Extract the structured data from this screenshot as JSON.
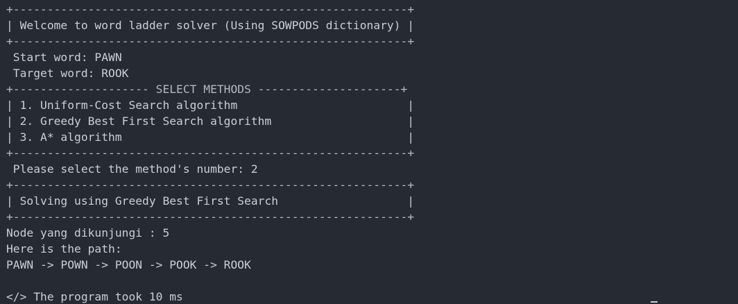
{
  "terminal": {
    "lines": [
      "+----------------------------------------------------------+",
      "| Welcome to word ladder solver (Using SOWPODS dictionary) |",
      "+----------------------------------------------------------+",
      " Start word: PAWN",
      " Target word: ROOK",
      "+-------------------- SELECT METHODS ---------------------+",
      "| 1. Uniform-Cost Search algorithm                         |",
      "| 2. Greedy Best First Search algorithm                    |",
      "| 3. A* algorithm                                          |",
      "+----------------------------------------------------------+",
      " Please select the method's number: 2",
      "+----------------------------------------------------------+",
      "| Solving using Greedy Best First Search                   |",
      "+----------------------------------------------------------+",
      "Node yang dikunjungi : 5",
      "Here is the path:",
      "PAWN -> POWN -> POON -> POOK -> ROOK",
      "",
      "</> The program took 10 ms"
    ]
  }
}
